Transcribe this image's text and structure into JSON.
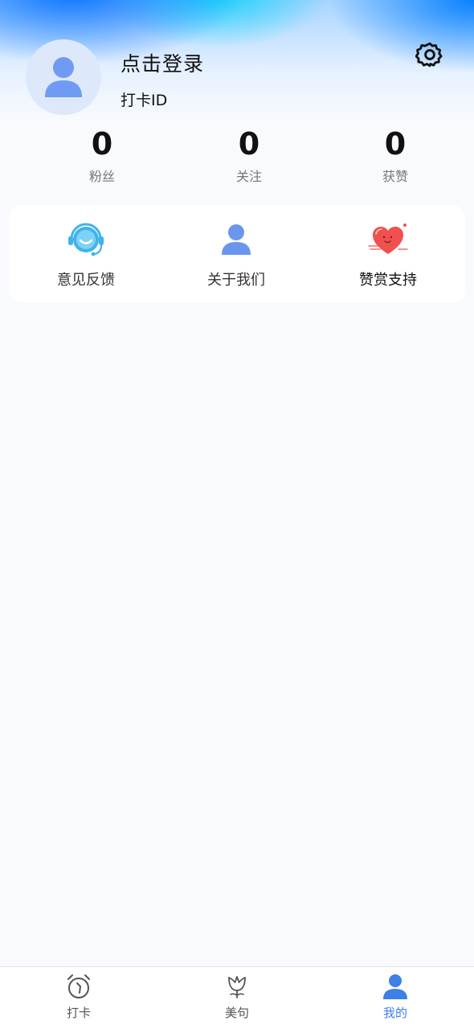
{
  "profile": {
    "login_title": "点击登录",
    "id_label": "打卡ID",
    "avatar_icon": "user-icon",
    "settings_icon": "gear-icon"
  },
  "stats": [
    {
      "value": "0",
      "label": "粉丝"
    },
    {
      "value": "0",
      "label": "关注"
    },
    {
      "value": "0",
      "label": "获赞"
    }
  ],
  "menu": [
    {
      "label": "意见反馈",
      "icon": "headset-smile-icon"
    },
    {
      "label": "关于我们",
      "icon": "user-icon"
    },
    {
      "label": "赞赏支持",
      "icon": "heart-icon"
    }
  ],
  "tabs": [
    {
      "label": "打卡",
      "icon": "alarm-clock-icon",
      "active": false
    },
    {
      "label": "美句",
      "icon": "tulip-icon",
      "active": false
    },
    {
      "label": "我的",
      "icon": "user-icon",
      "active": true
    }
  ],
  "colors": {
    "accent": "#3e7fe8",
    "avatar_bg": "#dde8fb",
    "avatar_fg": "#6f9bf4",
    "heart": "#f0504e"
  }
}
